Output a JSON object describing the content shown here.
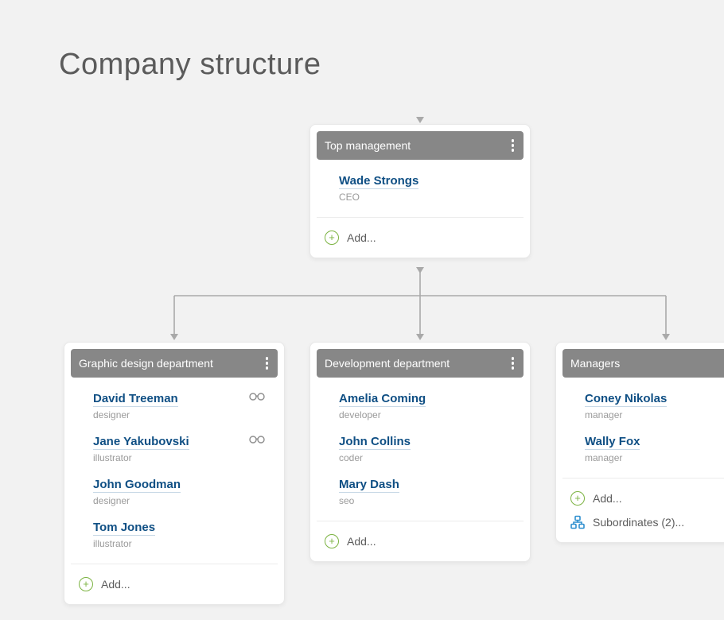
{
  "page": {
    "title": "Company structure"
  },
  "actions": {
    "add": "Add...",
    "subordinates_prefix": "Subordinates (",
    "subordinates_suffix": ")..."
  },
  "nodes": {
    "top": {
      "title": "Top management",
      "people": [
        {
          "name": "Wade Strongs",
          "role": "CEO"
        }
      ]
    },
    "design": {
      "title": "Graphic design department",
      "people": [
        {
          "name": "David Treeman",
          "role": "designer",
          "glasses": true
        },
        {
          "name": "Jane Yakubovski",
          "role": "illustrator",
          "glasses": true
        },
        {
          "name": "John Goodman",
          "role": "designer"
        },
        {
          "name": "Tom Jones",
          "role": "illustrator"
        }
      ]
    },
    "dev": {
      "title": "Development department",
      "people": [
        {
          "name": "Amelia Coming",
          "role": "developer"
        },
        {
          "name": "John Collins",
          "role": "coder"
        },
        {
          "name": "Mary Dash",
          "role": "seo"
        }
      ]
    },
    "managers": {
      "title": "Managers",
      "subordinate_count": 2,
      "people": [
        {
          "name": "Coney Nikolas",
          "role": "manager"
        },
        {
          "name": "Wally Fox",
          "role": "manager"
        }
      ]
    }
  }
}
